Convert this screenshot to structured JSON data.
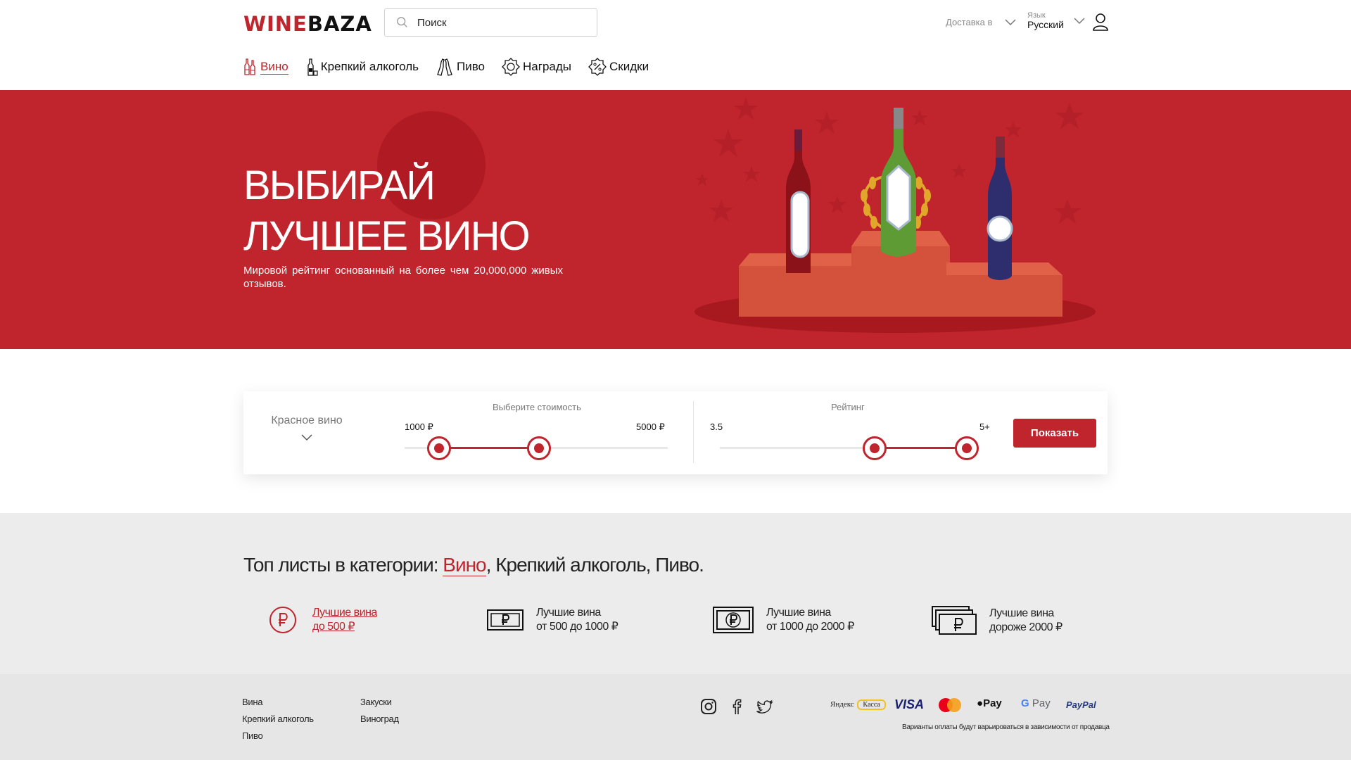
{
  "header": {
    "logo_part1": "WINE",
    "logo_part2": "BAZA",
    "search_placeholder": "Поиск",
    "delivery_label": "Доставка в",
    "language_label": "Язык",
    "language_value": "Русский"
  },
  "nav": {
    "items": [
      {
        "label": "Вино",
        "icon": "wine-bottles-icon",
        "active": true
      },
      {
        "label": "Крепкий алкоголь",
        "icon": "liquor-bottle-icon"
      },
      {
        "label": "Пиво",
        "icon": "beer-bottles-icon"
      },
      {
        "label": "Награды",
        "icon": "award-badge-icon"
      },
      {
        "label": "Скидки",
        "icon": "discount-badge-icon"
      }
    ]
  },
  "hero": {
    "title_line1": "ВЫБИРАЙ",
    "title_line2": "ЛУЧШЕЕ ВИНО",
    "subtitle": "Мировой рейтинг основанный на более чем 20,000,000 живых отзывов."
  },
  "filter": {
    "wine_type": "Красное вино",
    "price_label": "Выберите стоимость",
    "price_min": "1000 ₽",
    "price_max": "5000 ₽",
    "price_range_fraction": [
      0.13,
      0.51
    ],
    "rating_label": "Рейтинг",
    "rating_min": "3.5",
    "rating_max": "5+",
    "rating_range_fraction": [
      0.6,
      0.96
    ],
    "show_button": "Показать"
  },
  "toplists": {
    "title_prefix": "Топ листы в категории: ",
    "cat_active": "Вино",
    "cat_rest": ", Крепкий алкоголь, Пиво.",
    "items": [
      {
        "line1": "Лучшие вина",
        "line2": "до 500 ₽",
        "icon": "ruble-coin-icon",
        "active": true
      },
      {
        "line1": "Лучшие вина",
        "line2": "от 500 до 1000 ₽",
        "icon": "ruble-banknote-icon"
      },
      {
        "line1": "Лучшие вина",
        "line2": "от 1000 до 2000 ₽",
        "icon": "ruble-banknote-large-icon"
      },
      {
        "line1": "Лучшие вина",
        "line2": "дороже 2000 ₽",
        "icon": "ruble-banknotes-stack-icon"
      }
    ]
  },
  "footer": {
    "col1": [
      "Вина",
      "Крепкий алкоголь",
      "Пиво"
    ],
    "col2": [
      "Закуски",
      "Виноград"
    ],
    "social": [
      "instagram-icon",
      "facebook-icon",
      "twitter-icon"
    ],
    "payments": {
      "yandex": "Яндекс",
      "kassa": "Касса",
      "visa": "VISA",
      "applepay": "Pay",
      "gpay_g": "G",
      "gpay": "Pay",
      "paypal": "PayPal"
    },
    "payment_note": "Варианты оплаты будут варьироваться в зависимости от продавца"
  },
  "colors": {
    "brand_red": "#c0242c",
    "hero_circle": "#b01b23",
    "gray_band": "#ececec",
    "footer_bg": "#e6e6e6"
  }
}
